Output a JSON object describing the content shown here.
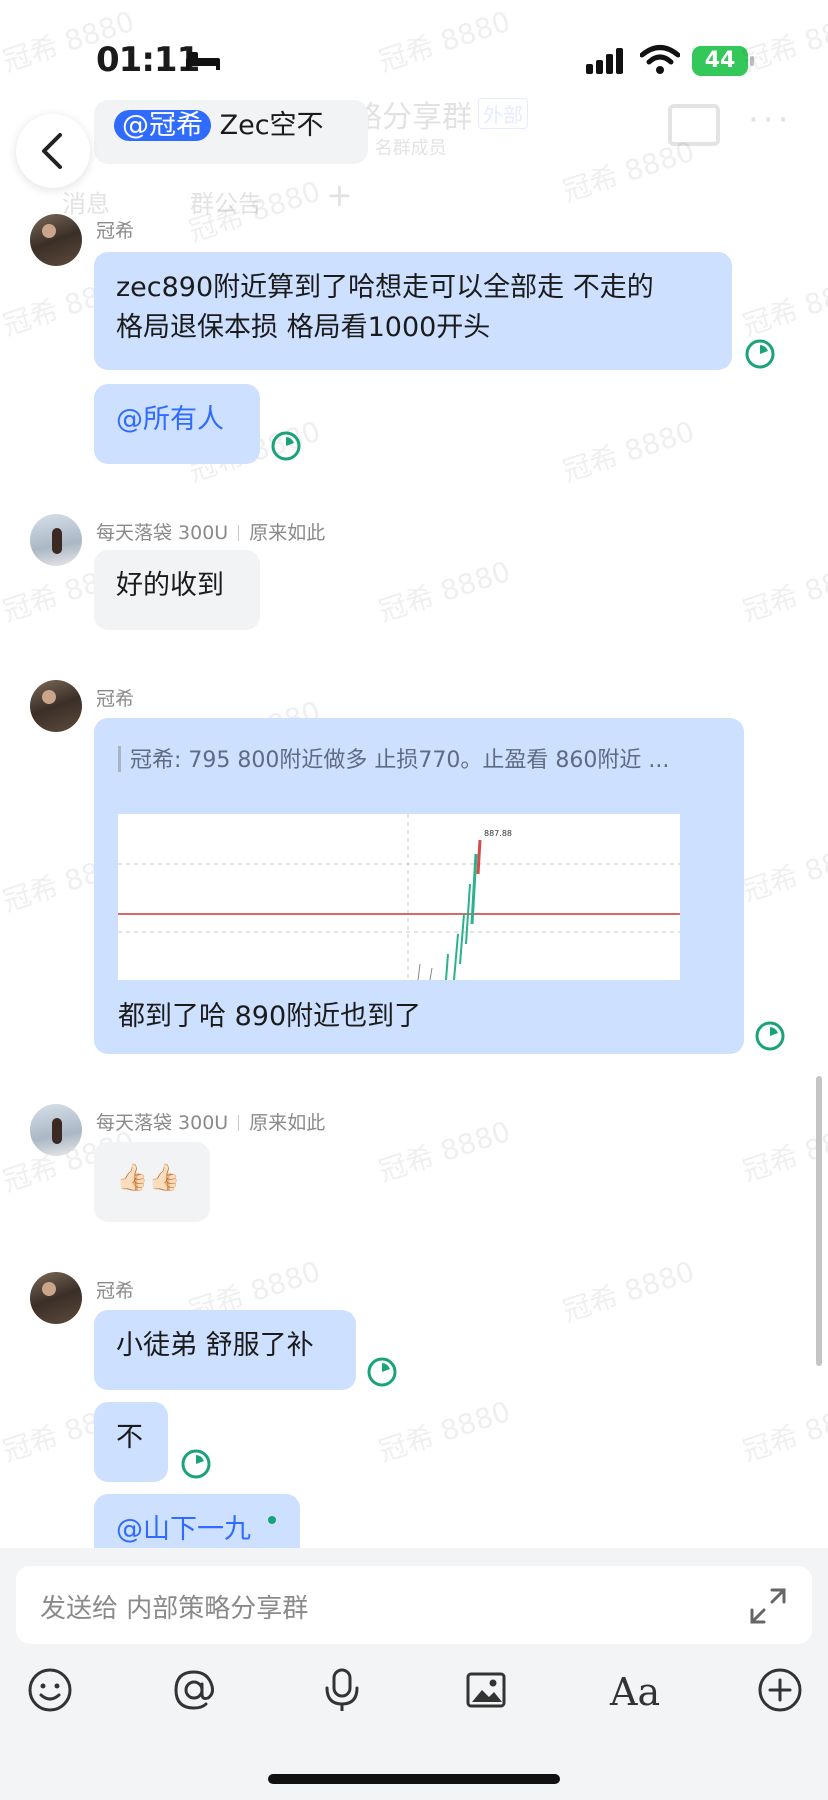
{
  "status_bar": {
    "time": "01:11",
    "battery": "44"
  },
  "header": {
    "title": "内部策略分享群",
    "tag": "外部",
    "subtitle": "32 名群成员",
    "tab_messages": "消息",
    "tab_notice": "群公告"
  },
  "watermark": "冠希 8880",
  "pinned_fragment": {
    "mention": "@冠希",
    "text": "Zec空不"
  },
  "messages": [
    {
      "sender": "冠希",
      "text_line1": "zec890附近算到了哈想走可以全部走 不走的",
      "text_line2": "格局退保本损 格局看1000开头"
    },
    {
      "mention": "@所有人"
    },
    {
      "sender": "每天落袋 300U",
      "reply_ref": "原来如此",
      "text": "好的收到"
    },
    {
      "sender": "冠希",
      "quote": "冠希: 795 800附近做多 止损770。止盈看 860附近 ...",
      "image_label": "887.88",
      "text": "都到了哈  890附近也到了"
    },
    {
      "sender": "每天落袋 300U",
      "reply_ref": "原来如此",
      "emoji": "👍🏻👍🏻"
    },
    {
      "sender": "冠希",
      "text": "小徒弟 舒服了补"
    },
    {
      "text": "不"
    },
    {
      "mention": "@山下一九"
    }
  ],
  "input": {
    "placeholder": "发送给 内部策略分享群"
  },
  "toolbar": [
    "emoji-icon",
    "at-icon",
    "microphone-icon",
    "image-icon",
    "text-format-icon",
    "plus-icon"
  ],
  "toolbar_text_format_label": "Aa",
  "colors": {
    "bubble_blue": "#cde0ff",
    "bubble_grey": "#f2f3f5",
    "accent": "#2f6bff",
    "timer": "#1aa37a"
  }
}
